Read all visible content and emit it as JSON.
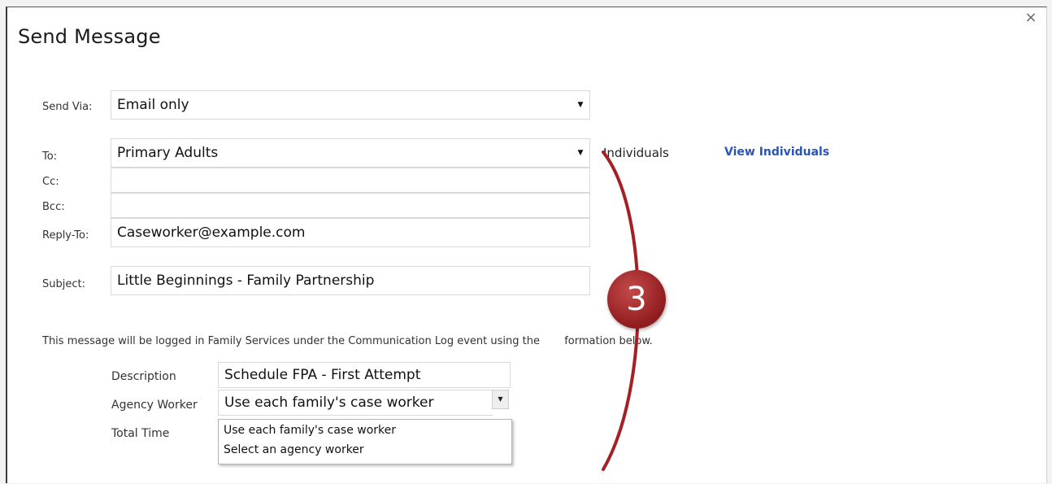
{
  "dialog": {
    "title": "Send Message",
    "close_glyph": "×"
  },
  "form": {
    "send_via": {
      "label": "Send Via:",
      "value": "Email only"
    },
    "to": {
      "label": "To:",
      "value": "Primary Adults"
    },
    "cc": {
      "label": "Cc:",
      "value": ""
    },
    "bcc": {
      "label": "Bcc:",
      "value": ""
    },
    "reply_to": {
      "label": "Reply-To:",
      "value": "Caseworker@example.com"
    },
    "subject": {
      "label": "Subject:",
      "value": "Little Beginnings - Family Partnership"
    },
    "individuals_text": "Individuals",
    "view_individuals": "View Individuals"
  },
  "log": {
    "note_part1": "This message will be logged in Family Services under the Communication Log event using the",
    "note_part2": "formation below.",
    "description": {
      "label": "Description",
      "value": "Schedule FPA - First Attempt"
    },
    "agency_worker": {
      "label": "Agency Worker",
      "value": "Use each family's case worker",
      "options": [
        "Use each family's case worker",
        "Select an agency worker"
      ]
    },
    "total_time": {
      "label": "Total Time"
    }
  },
  "annotation": {
    "callout_number": "3",
    "color": "#a32024"
  },
  "icons": {
    "dropdown": "caret-down-icon",
    "close": "close-icon"
  }
}
